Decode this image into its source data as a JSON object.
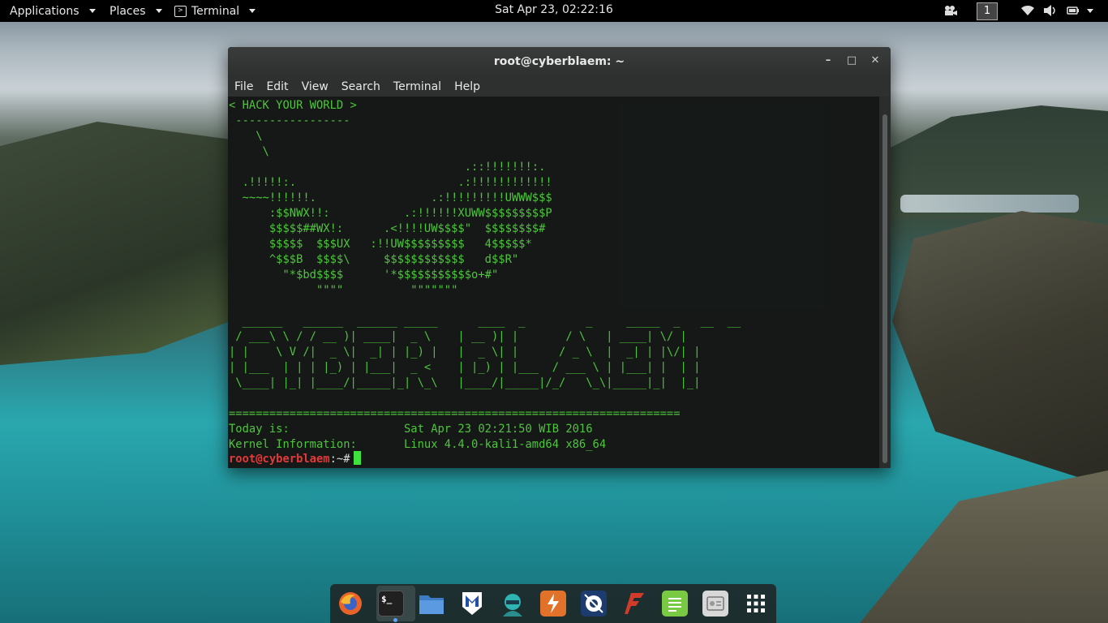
{
  "topbar": {
    "applications": "Applications",
    "places": "Places",
    "active_app": "Terminal",
    "clock": "Sat Apr 23, 02:22:16",
    "workspace": "1"
  },
  "window": {
    "title": "root@cyberblaem: ~",
    "menu": [
      "File",
      "Edit",
      "View",
      "Search",
      "Terminal",
      "Help"
    ]
  },
  "terminal": {
    "ascii_art": "< HACK YOUR WORLD >\n -----------------\n    \\\n     \\\n                                   .::!!!!!!!:.\n  .!!!!!:.                        .:!!!!!!!!!!!!\n  ~~~~!!!!!!.                 .:!!!!!!!!!UWWW$$$\n      :$$NWX!!:           .:!!!!!!XUWW$$$$$$$$$P\n      $$$$$##WX!:      .<!!!!UW$$$$\"  $$$$$$$$#\n      $$$$$  $$$UX   :!!UW$$$$$$$$$   4$$$$$*\n      ^$$$B  $$$$\\     $$$$$$$$$$$$   d$$R\"\n        \"*$bd$$$$      '*$$$$$$$$$$$o+#\"\n             \"\"\"\"          \"\"\"\"\"\"\"\n\n  ______   ______  ______ _____      ____  _         _     _____  _   __  __\n / ___\\ \\ / / __ )| ____|  _ \\    | __ )| |       / \\   | ____| \\/ |\n| |    \\ V /|  _ \\|  _| | |_) |   |  _ \\| |      / _ \\  |  _| | |\\/| |\n| |___  | | | |_) | |___|  _ <    | |_) | |___  / ___ \\ | |___| |  | |\n \\____| |_| |____/|_____|_| \\_\\   |____/|_____|/_/   \\_\\|_____|_|  |_|\n\n===================================================================\nToday is:                 Sat Apr 23 02:21:50 WIB 2016\nKernel Information:       Linux 4.4.0-kali1-amd64 x86_64",
    "prompt_user": "root@cyberblaem",
    "prompt_rest": ":~#"
  },
  "dock": [
    {
      "name": "Firefox",
      "icon": "firefox-icon",
      "color": "#e8632a"
    },
    {
      "name": "Terminal",
      "icon": "terminal-icon",
      "color": "#2a2a2a"
    },
    {
      "name": "Files",
      "icon": "folder-icon",
      "color": "#4a8fd6"
    },
    {
      "name": "Metasploit",
      "icon": "metasploit-icon",
      "color": "#1f4fa8"
    },
    {
      "name": "Armitage",
      "icon": "armitage-icon",
      "color": "#2fb3b3"
    },
    {
      "name": "Burp Suite",
      "icon": "burpsuite-icon",
      "color": "#e2712a"
    },
    {
      "name": "Maltego",
      "icon": "maltego-icon",
      "color": "#1d3b6e"
    },
    {
      "name": "Faraday",
      "icon": "faraday-icon",
      "color": "#d23b2a"
    },
    {
      "name": "Notes",
      "icon": "notes-icon",
      "color": "#7ac943"
    },
    {
      "name": "Settings",
      "icon": "settings-icon",
      "color": "#d8d8d8"
    },
    {
      "name": "Show Applications",
      "icon": "app-grid-icon",
      "color": "#ffffff"
    }
  ]
}
